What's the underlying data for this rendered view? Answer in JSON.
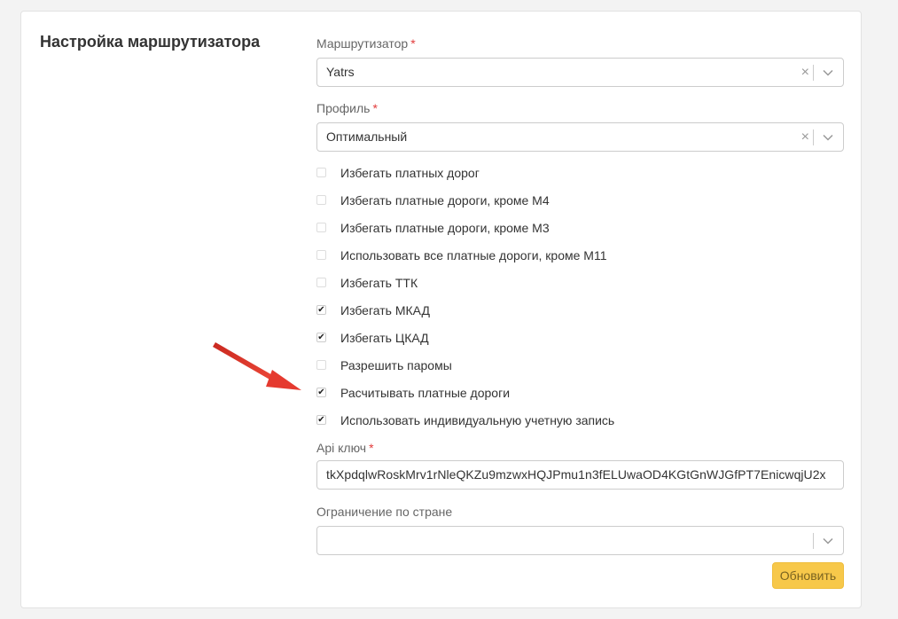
{
  "section": {
    "title": "Настройка маршрутизатора"
  },
  "router": {
    "label": "Маршрутизатор",
    "required_mark": "*",
    "value": "Yatrs",
    "clear_symbol": "×"
  },
  "profile": {
    "label": "Профиль",
    "required_mark": "*",
    "value": "Оптимальный",
    "clear_symbol": "×"
  },
  "options": [
    {
      "label": "Избегать платных дорог",
      "checked": false
    },
    {
      "label": "Избегать платные дороги, кроме М4",
      "checked": false
    },
    {
      "label": "Избегать платные дороги, кроме М3",
      "checked": false
    },
    {
      "label": "Использовать все платные дороги, кроме М11",
      "checked": false
    },
    {
      "label": "Избегать ТТК",
      "checked": false
    },
    {
      "label": "Избегать МКАД",
      "checked": true
    },
    {
      "label": "Избегать ЦКАД",
      "checked": true
    },
    {
      "label": "Разрешить паромы",
      "checked": false
    },
    {
      "label": "Расчитывать платные дороги",
      "checked": true
    },
    {
      "label": "Использовать индивидуальную учетную запись",
      "checked": true
    }
  ],
  "check_symbol": "✔",
  "api_key": {
    "label": "Api ключ",
    "required_mark": "*",
    "value": "tkXpdqlwRoskMrv1rNleQKZu9mzwxHQJPmu1n3fELUwaOD4KGtGnWJGfPT7EnicwqjU2x"
  },
  "country": {
    "label": "Ограничение по стране",
    "value": ""
  },
  "update_button": {
    "label": "Обновить"
  },
  "colors": {
    "accent": "#f7c84a",
    "required": "#e23b3b",
    "arrow": "#e53a2f"
  }
}
